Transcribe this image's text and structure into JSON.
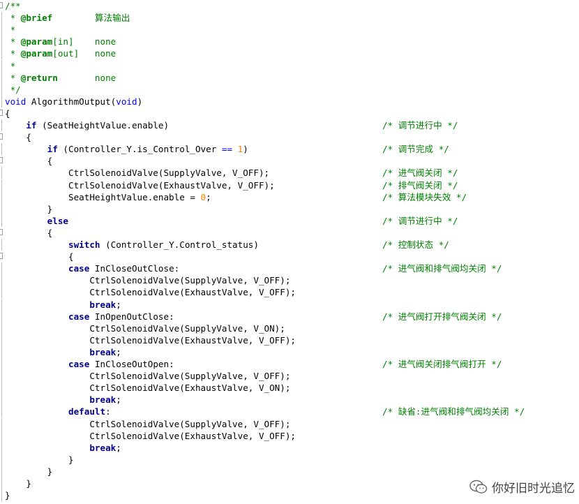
{
  "watermark": {
    "text": "你好旧时光追忆",
    "icon": "wechat-icon"
  },
  "colors": {
    "comment": "#008000",
    "keyword": "#00008b",
    "number": "#ff8000",
    "operator": "#0000ff"
  },
  "lines": [
    {
      "tokens": [
        {
          "t": "/**",
          "c": "doc"
        }
      ],
      "fold": "mark"
    },
    {
      "tokens": [
        {
          "t": " * ",
          "c": "doc"
        },
        {
          "t": "@brief",
          "c": "tag"
        },
        {
          "t": "        算法输出",
          "c": "doc"
        }
      ]
    },
    {
      "tokens": [
        {
          "t": " *",
          "c": "doc"
        }
      ]
    },
    {
      "tokens": [
        {
          "t": " * ",
          "c": "doc"
        },
        {
          "t": "@param",
          "c": "tag"
        },
        {
          "t": "[in]    none",
          "c": "doc"
        }
      ]
    },
    {
      "tokens": [
        {
          "t": " * ",
          "c": "doc"
        },
        {
          "t": "@param",
          "c": "tag"
        },
        {
          "t": "[out]   none",
          "c": "doc"
        }
      ]
    },
    {
      "tokens": [
        {
          "t": " *",
          "c": "doc"
        }
      ]
    },
    {
      "tokens": [
        {
          "t": " * ",
          "c": "doc"
        },
        {
          "t": "@return",
          "c": "tag"
        },
        {
          "t": "       none",
          "c": "doc"
        }
      ]
    },
    {
      "tokens": [
        {
          "t": " */",
          "c": "doc"
        }
      ]
    },
    {
      "tokens": [
        {
          "t": "void",
          "c": "void"
        },
        {
          "t": " AlgorithmOutput("
        },
        {
          "t": "void",
          "c": "void"
        },
        {
          "t": ")"
        }
      ]
    },
    {
      "tokens": [
        {
          "t": "{"
        }
      ],
      "fold": "mark"
    },
    {
      "tokens": [
        {
          "t": "    "
        },
        {
          "t": "if",
          "c": "kw"
        },
        {
          "t": " (SeatHeightValue.enable)"
        }
      ],
      "comment": "/* 调节进行中 */"
    },
    {
      "tokens": [
        {
          "t": "    {"
        }
      ],
      "fold": "mark"
    },
    {
      "tokens": [
        {
          "t": "        "
        },
        {
          "t": "if",
          "c": "kw"
        },
        {
          "t": " (Controller_Y.is_Control_Over "
        },
        {
          "t": "==",
          "c": "op"
        },
        {
          "t": " "
        },
        {
          "t": "1",
          "c": "num"
        },
        {
          "t": ")"
        }
      ],
      "comment": "/* 调节完成 */"
    },
    {
      "tokens": [
        {
          "t": "        {"
        }
      ],
      "fold": "mark"
    },
    {
      "tokens": [
        {
          "t": "            CtrlSolenoidValve(SupplyValve, V_OFF);"
        }
      ],
      "comment": "/* 进气阀关闭 */"
    },
    {
      "tokens": [
        {
          "t": "            CtrlSolenoidValve(ExhaustValve, V_OFF);"
        }
      ],
      "comment": "/* 排气阀关闭 */"
    },
    {
      "tokens": [
        {
          "t": "            SeatHeightValue.enable = "
        },
        {
          "t": "0",
          "c": "num"
        },
        {
          "t": ";"
        }
      ],
      "comment": "/* 算法模块失效 */"
    },
    {
      "tokens": [
        {
          "t": "        }"
        }
      ]
    },
    {
      "tokens": [
        {
          "t": "        "
        },
        {
          "t": "else",
          "c": "kw"
        }
      ],
      "comment": "/* 调节进行中 */"
    },
    {
      "tokens": [
        {
          "t": "        {"
        }
      ],
      "fold": "mark"
    },
    {
      "tokens": [
        {
          "t": "            "
        },
        {
          "t": "switch",
          "c": "kw"
        },
        {
          "t": " (Controller_Y.Control_status)"
        }
      ],
      "comment": "/* 控制状态 */"
    },
    {
      "tokens": [
        {
          "t": "            {"
        }
      ],
      "fold": "mark"
    },
    {
      "tokens": [
        {
          "t": "            "
        },
        {
          "t": "case",
          "c": "kw"
        },
        {
          "t": " InCloseOutClose:"
        }
      ],
      "comment": "/* 进气阀和排气阀均关闭 */"
    },
    {
      "tokens": [
        {
          "t": "                CtrlSolenoidValve(SupplyValve, V_OFF);"
        }
      ]
    },
    {
      "tokens": [
        {
          "t": "                CtrlSolenoidValve(ExhaustValve, V_OFF);"
        }
      ]
    },
    {
      "tokens": [
        {
          "t": "                "
        },
        {
          "t": "break",
          "c": "kw"
        },
        {
          "t": ";"
        }
      ]
    },
    {
      "tokens": [
        {
          "t": "            "
        },
        {
          "t": "case",
          "c": "kw"
        },
        {
          "t": " InOpenOutClose:"
        }
      ],
      "comment": "/* 进气阀打开排气阀关闭 */"
    },
    {
      "tokens": [
        {
          "t": "                CtrlSolenoidValve(SupplyValve, V_ON);"
        }
      ]
    },
    {
      "tokens": [
        {
          "t": "                CtrlSolenoidValve(ExhaustValve, V_OFF);"
        }
      ]
    },
    {
      "tokens": [
        {
          "t": "                "
        },
        {
          "t": "break",
          "c": "kw"
        },
        {
          "t": ";"
        }
      ]
    },
    {
      "tokens": [
        {
          "t": "            "
        },
        {
          "t": "case",
          "c": "kw"
        },
        {
          "t": " InCloseOutOpen:"
        }
      ],
      "comment": "/* 进气阀关闭排气阀打开 */"
    },
    {
      "tokens": [
        {
          "t": "                CtrlSolenoidValve(SupplyValve, V_OFF);"
        }
      ]
    },
    {
      "tokens": [
        {
          "t": "                CtrlSolenoidValve(ExhaustValve, V_ON);"
        }
      ]
    },
    {
      "tokens": [
        {
          "t": "                "
        },
        {
          "t": "break",
          "c": "kw"
        },
        {
          "t": ";"
        }
      ]
    },
    {
      "tokens": [
        {
          "t": "            "
        },
        {
          "t": "default",
          "c": "kw"
        },
        {
          "t": ":"
        }
      ],
      "comment": "/* 缺省:进气阀和排气阀均关闭 */"
    },
    {
      "tokens": [
        {
          "t": "                CtrlSolenoidValve(SupplyValve, V_OFF);"
        }
      ]
    },
    {
      "tokens": [
        {
          "t": "                CtrlSolenoidValve(ExhaustValve, V_OFF);"
        }
      ]
    },
    {
      "tokens": [
        {
          "t": "                "
        },
        {
          "t": "break",
          "c": "kw"
        },
        {
          "t": ";"
        }
      ]
    },
    {
      "tokens": [
        {
          "t": "            }"
        }
      ]
    },
    {
      "tokens": [
        {
          "t": "        }"
        }
      ]
    },
    {
      "tokens": [
        {
          "t": "    }"
        }
      ]
    },
    {
      "tokens": [
        {
          "t": "}"
        }
      ]
    }
  ]
}
